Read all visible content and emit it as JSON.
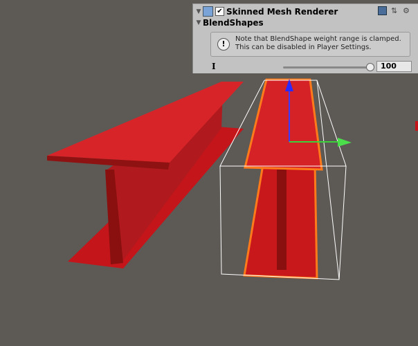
{
  "component": {
    "title": "Skinned Mesh Renderer",
    "enabled": true,
    "section": "BlendShapes"
  },
  "help": {
    "icon": "warning-icon",
    "text1": "Note that BlendShape weight range is clamped.",
    "text2": "This can be disabled in Player Settings."
  },
  "blendshape": {
    "name": "I",
    "value": "100",
    "fraction": 1.0
  },
  "icons": [
    "help-book-icon",
    "preset-icon",
    "gear-icon"
  ]
}
